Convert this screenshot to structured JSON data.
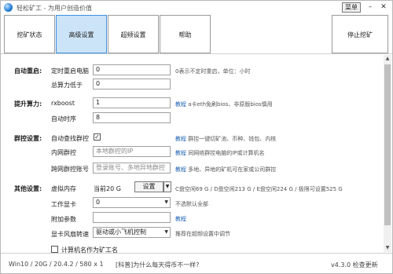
{
  "window": {
    "title": "轻松矿工 - 为用户创造价值",
    "menu_label": "菜单",
    "minimize": "–",
    "close": "✕"
  },
  "tabs": [
    {
      "label": "挖矿状态",
      "active": false
    },
    {
      "label": "高级设置",
      "active": true
    },
    {
      "label": "超频设置",
      "active": false
    },
    {
      "label": "帮助",
      "active": false
    }
  ],
  "stop_button": "停止挖矿",
  "auto_restart": {
    "section": "自动重启:",
    "timed_label": "定时重启电脑",
    "timed_value": "0",
    "timed_hint": "0表示不定时重启，单位：小时",
    "low_power_label": "总算力低于",
    "low_power_value": "0"
  },
  "boost": {
    "section": "提升算力:",
    "rxboost_label": "rxboost",
    "rxboost_value": "1",
    "rxboost_hint_link": "教程",
    "rxboost_hint": "a卡eth免刷bios、非原版bios慎用",
    "timing_label": "自动时序",
    "timing_value": "8"
  },
  "group": {
    "section": "群控设置:",
    "auto_find_label": "自动查找群控",
    "auto_find_checked": true,
    "auto_find_hint_link": "教程",
    "auto_find_hint": "群控一键切矿池、币种、钱包、内核",
    "intranet_label": "内网群控",
    "intranet_placeholder": "本地群控的IP",
    "intranet_hint_link": "教程",
    "intranet_hint": "同网络群控电脑的IP或计算机名",
    "remote_label": "跨网群控账号",
    "remote_placeholder": "登录账号、多地异地群控",
    "remote_hint_link": "教程",
    "remote_hint": "多地、异地的矿机可在家或公司群控"
  },
  "other": {
    "section": "其他设置:",
    "vmem_label": "虚拟内存",
    "vmem_current": "当前20 G",
    "vmem_button": "设置",
    "vmem_hint": "C盘空闲69 G / D盘空闲213 G / E盘空闲224 G / 极限可设置525 G",
    "gpu_label": "工作显卡",
    "gpu_value": "0",
    "gpu_hint": "不选默认全部",
    "params_label": "附加参数",
    "params_value": "",
    "params_hint_link": "教程",
    "fan_label": "显卡风扇转速",
    "fan_value": "驱动或小飞机控制",
    "fan_hint": "推荐在超频设置中调节",
    "hostname_label": "计算机名作为矿工名",
    "hostname_checked": false
  },
  "status": {
    "info": "Win10  / 20G / 20.4.2 / 580 x 1",
    "link": "[科普]为什么每天得币不一样?",
    "version": "v4.3.0 检查更新"
  }
}
